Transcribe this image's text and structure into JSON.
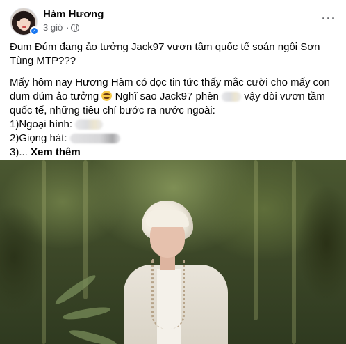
{
  "post": {
    "author": "Hàm Hương",
    "time": "3 giờ ·",
    "privacy_icon": "globe-icon",
    "more_icon": "more-options-icon",
    "more_label": "···",
    "verified_icon": "verified-badge-icon",
    "text": {
      "title_line": "Đum Đúm đang ảo tưởng Jack97 vươn tầm quốc tế soán ngôi Sơn Tùng MTP???",
      "para_before_emoji": "Mấy hôm nay Hương Hàm có đọc tin tức thấy mắc cười cho mấy con đum đúm ảo tưởng",
      "para_after_emoji": "Nghĩ sao Jack97 phèn",
      "para_after_blur": "vậy đòi vươn tầm quốc tế, những tiêu chí bước ra nước ngoài:",
      "item1_label": "1)Ngoại hình:",
      "item2_label": "2)Giọng hát:",
      "item3_prefix": "3)...",
      "see_more": "Xem thêm"
    }
  },
  "colors": {
    "text": "#050505",
    "secondary": "#65676b",
    "verified": "#1877f2"
  }
}
